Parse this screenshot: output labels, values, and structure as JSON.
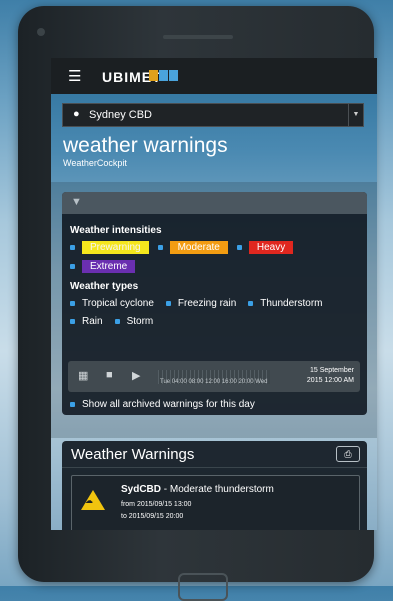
{
  "app": {
    "logo_main": "UBIMET",
    "logo_squares": [
      "#e0a11b",
      "#4aa3dc",
      "#4aa3dc"
    ]
  },
  "location": {
    "icon": "map-pin-icon",
    "value": "Sydney CBD"
  },
  "page": {
    "title": "weather warnings",
    "subtitle": "WeatherCockpit"
  },
  "filter": {
    "intensities_label": "Weather intensities",
    "intensities": [
      {
        "label": "Prewarning",
        "bg": "#f5e61d",
        "fg": "#f5f5f5"
      },
      {
        "label": "Moderate",
        "bg": "#f39c12",
        "fg": "#ffffff"
      },
      {
        "label": "Heavy",
        "bg": "#e0271f",
        "fg": "#ffffff"
      },
      {
        "label": "Extreme",
        "bg": "#6a2fb0",
        "fg": "#ffffff"
      }
    ],
    "types_label": "Weather types",
    "types_row1": [
      "Tropical cyclone",
      "Freezing rain",
      "Thunderstorm"
    ],
    "types_row2": [
      "Rain",
      "Storm"
    ],
    "timeline_labels": "Tue 04:00 08:00 12:00 16:00 20:00 Wed",
    "date_line1": "15 September",
    "date_line2": "2015 12:00 AM",
    "archive_label": "Show all archived warnings for this day"
  },
  "warnings": {
    "title": "Weather Warnings",
    "items": [
      {
        "code": "SydCBD",
        "description": " - Moderate thunderstorm",
        "from": "from 2015/09/15 13:00",
        "to": "to 2015/09/15 20:00"
      }
    ]
  }
}
